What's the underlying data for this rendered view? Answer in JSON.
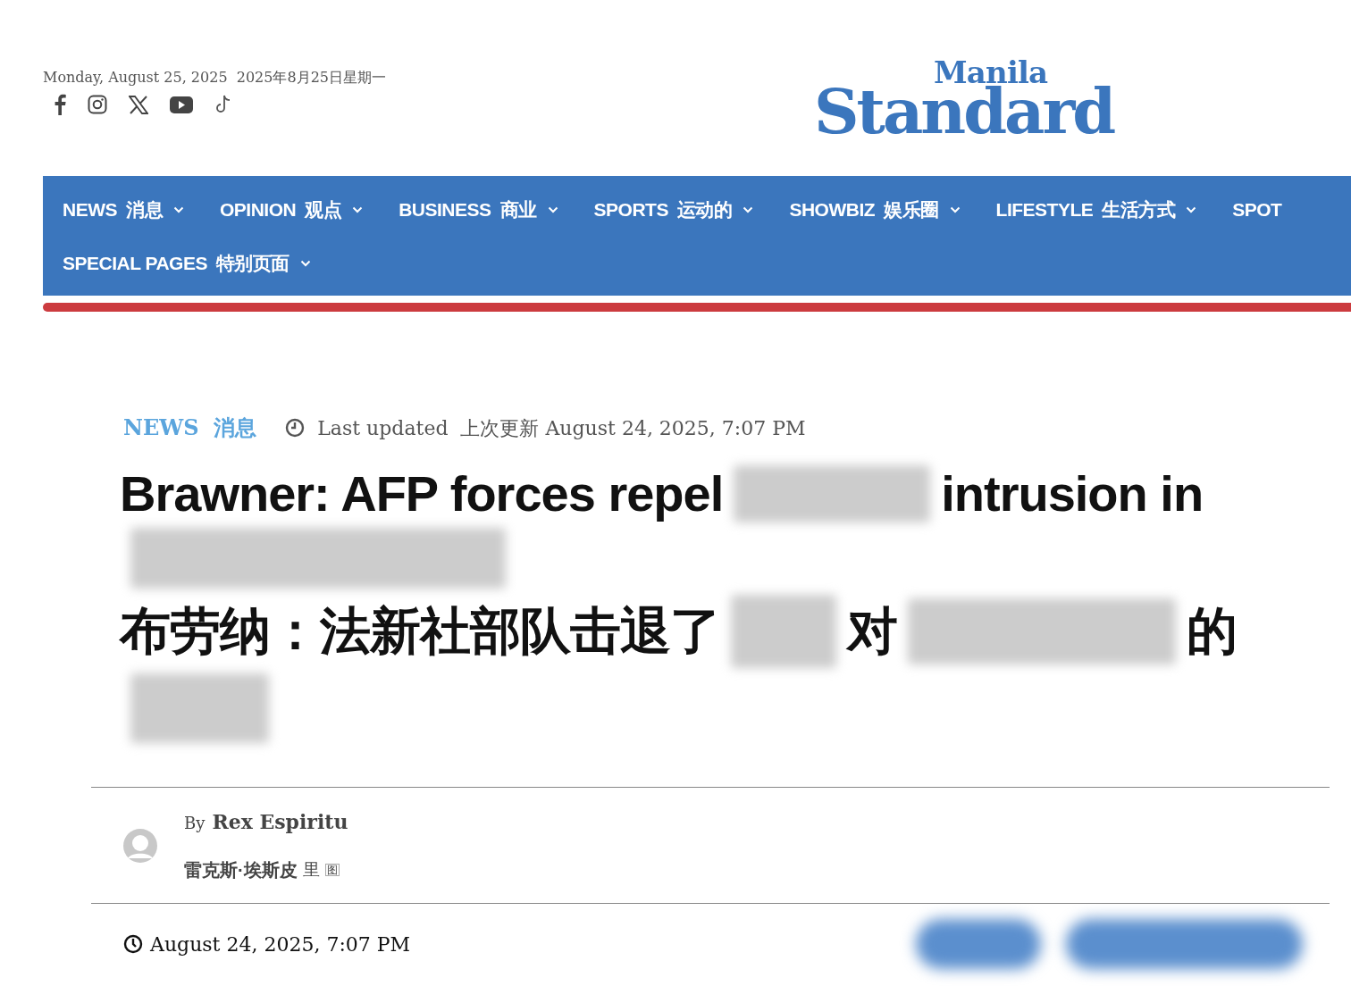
{
  "header": {
    "date": "Monday, August 25, 2025",
    "date_zh": "2025年8月25日星期一",
    "social": [
      {
        "kind": "facebook"
      },
      {
        "kind": "instagram"
      },
      {
        "kind": "x"
      },
      {
        "kind": "youtube"
      },
      {
        "kind": "tiktok"
      }
    ],
    "logo_top": "Manila",
    "logo_main": "Standard"
  },
  "nav": {
    "rows": [
      [
        {
          "label": "NEWS",
          "label_zh": "消息",
          "caret": true
        },
        {
          "label": "OPINION",
          "label_zh": "观点",
          "caret": true
        },
        {
          "label": "BUSINESS",
          "label_zh": "商业",
          "caret": true
        },
        {
          "label": "SPORTS",
          "label_zh": "运动的",
          "caret": true
        },
        {
          "label": "SHOWBIZ",
          "label_zh": "娱乐圈",
          "caret": true
        },
        {
          "label": "LIFESTYLE",
          "label_zh": "生活方式",
          "caret": true
        },
        {
          "label": "SPOT",
          "caret": false
        }
      ],
      [
        {
          "label": "SPECIAL PAGES",
          "label_zh": "特别页面",
          "caret": true
        }
      ]
    ]
  },
  "article": {
    "category": "NEWS",
    "category_zh": "消息",
    "updated_label": "Last updated",
    "updated_label_zh": "上次更新",
    "updated": "August 24, 2025, 7:07 PM",
    "headline_lines": [
      [
        {
          "kind": "text",
          "text": "Brawner: AFP forces repel"
        },
        {
          "kind": "blurred"
        },
        {
          "kind": "text",
          "text": "intrusion in"
        }
      ],
      [
        {
          "kind": "blurred"
        }
      ],
      [
        {
          "kind": "text",
          "text": "布劳纳：法新社部队击退了"
        },
        {
          "kind": "blurred"
        },
        {
          "kind": "text",
          "text": "对"
        },
        {
          "kind": "blurred"
        },
        {
          "kind": "text",
          "text": "的"
        }
      ],
      [
        {
          "kind": "blurred"
        }
      ]
    ],
    "by": "By",
    "author": "Rex Espiritu",
    "author_zh": "雷克斯·埃斯皮",
    "author_zh_tail": "里",
    "author_zh_mark": "图",
    "date": "August 24, 2025, 7:07 PM",
    "share": [
      {
        "kind": "blurred"
      },
      {
        "kind": "blurred"
      }
    ]
  }
}
